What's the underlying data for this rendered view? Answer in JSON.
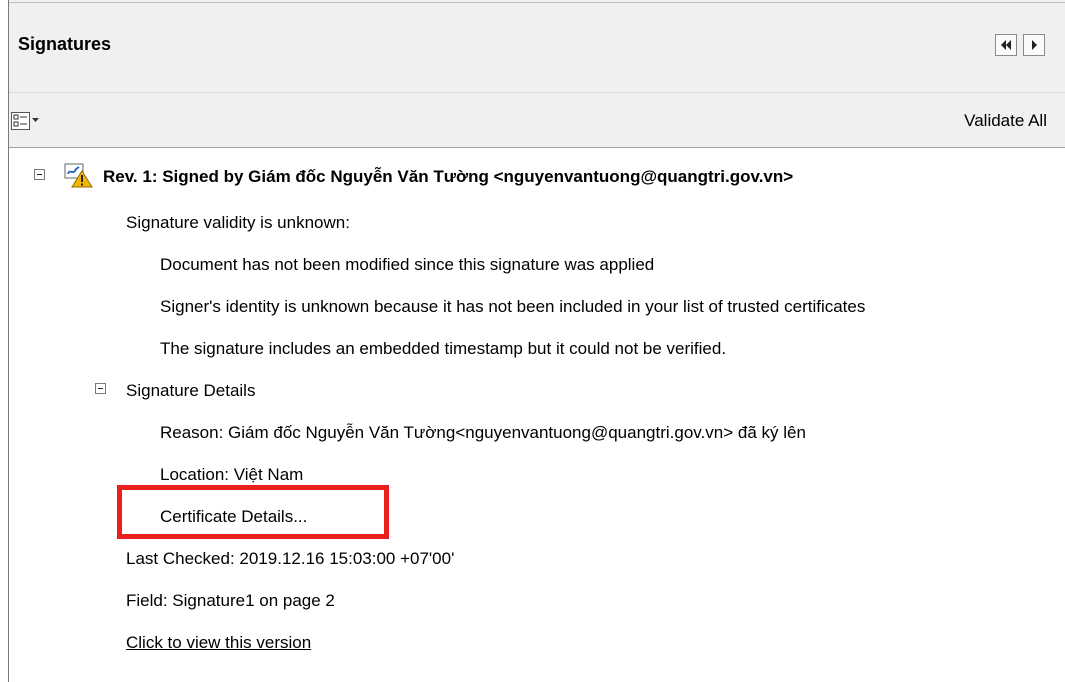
{
  "panel": {
    "title": "Signatures"
  },
  "toolbar": {
    "validate_all_label": "Validate All",
    "options_icon": "list-options-icon"
  },
  "signature": {
    "header": "Rev. 1: Signed by Giám đốc Nguyễn Văn Tường <nguyenvantuong@quangtri.gov.vn>",
    "validity_status": "Signature validity is unknown:",
    "validity_items": [
      "Document has not been modified since this signature was applied",
      "Signer's identity is unknown because it has not been included in your list of trusted certificates",
      "The signature includes an embedded timestamp but it could not be verified."
    ],
    "details_label": "Signature Details",
    "reason": "Reason: Giám đốc Nguyễn Văn Tường<nguyenvantuong@quangtri.gov.vn> đã ký lên",
    "location": "Location: Việt Nam",
    "certificate_details": "Certificate Details...",
    "last_checked": "Last Checked: 2019.12.16 15:03:00 +07'00'",
    "field": "Field: Signature1 on page 2",
    "view_version_link": "Click to view this version"
  },
  "colors": {
    "highlight": "#e8201e",
    "warning_icon": "#f2b705"
  }
}
